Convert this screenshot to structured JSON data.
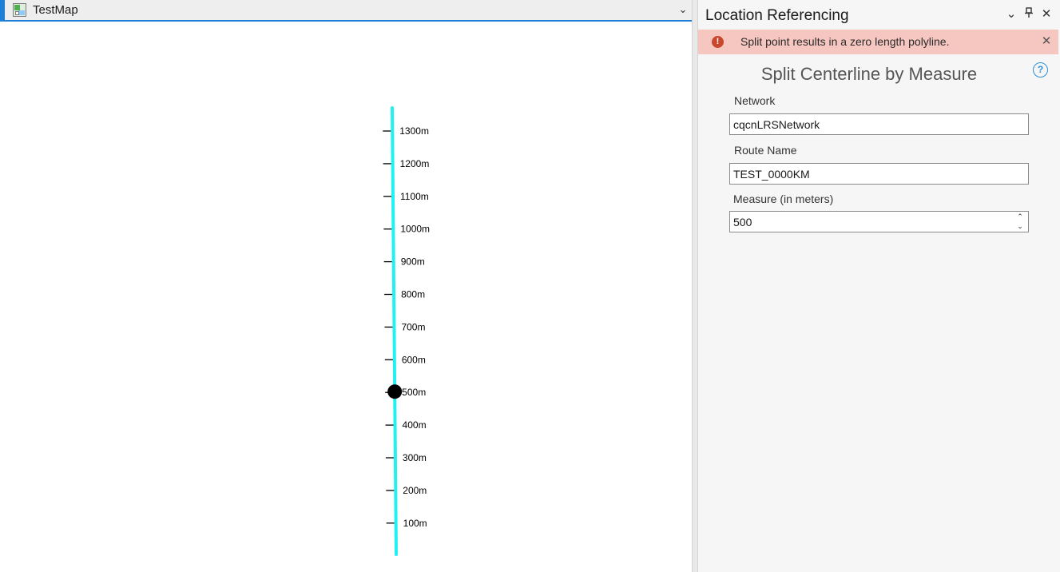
{
  "map_tab": {
    "title": "TestMap",
    "dropdown_glyph": "⌄"
  },
  "route": {
    "color": "#22f1f1",
    "measures": [
      "1300m",
      "1200m",
      "1100m",
      "1000m",
      "900m",
      "800m",
      "700m",
      "600m",
      "500m",
      "400m",
      "300m",
      "200m",
      "100m"
    ],
    "split_point_measure": 500
  },
  "pane": {
    "title": "Location Referencing",
    "controls": {
      "dropdown": "⌄",
      "pin": "📌",
      "close": "✕"
    },
    "error": {
      "message": "Split point results in a zero length polyline.",
      "icon_glyph": "!",
      "close_glyph": "✕"
    },
    "tool_title": "Split Centerline by Measure",
    "help_glyph": "?",
    "fields": {
      "network_label": "Network",
      "network_value": "cqcnLRSNetwork",
      "route_label": "Route Name",
      "route_value": "TEST_0000KM",
      "measure_label": "Measure (in meters)",
      "measure_value": "500"
    },
    "stepper": {
      "up": "⌃",
      "down": "⌄"
    }
  },
  "colors": {
    "accent": "#1e7fd6",
    "error_bg": "#f6c6c0",
    "error_icon": "#c8472d",
    "help": "#2f8fd8"
  }
}
